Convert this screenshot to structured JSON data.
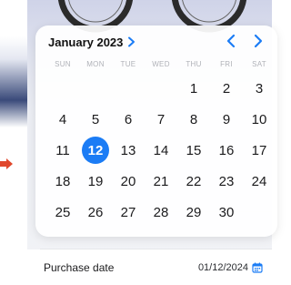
{
  "calendar": {
    "month_label": "January 2023",
    "weekdays": [
      "SUN",
      "MON",
      "TUE",
      "WED",
      "THU",
      "FRI",
      "SAT"
    ],
    "days": [
      [
        "",
        "",
        "",
        "",
        "1",
        "2",
        "3"
      ],
      [
        "4",
        "5",
        "6",
        "7",
        "8",
        "9",
        "10"
      ],
      [
        "11",
        "12",
        "13",
        "14",
        "15",
        "16",
        "17"
      ],
      [
        "18",
        "19",
        "20",
        "21",
        "22",
        "23",
        "24"
      ],
      [
        "25",
        "26",
        "27",
        "28",
        "29",
        "30",
        ""
      ]
    ],
    "selected_day": "12",
    "accent_color": "#1b7cf5"
  },
  "form": {
    "purchase_date_label": "Purchase date",
    "purchase_date_value": "01/12/2024"
  },
  "icons": {
    "prev": "chevron-left-icon",
    "next": "chevron-right-icon",
    "month_picker": "chevron-right-icon",
    "date_field": "calendar-icon"
  }
}
